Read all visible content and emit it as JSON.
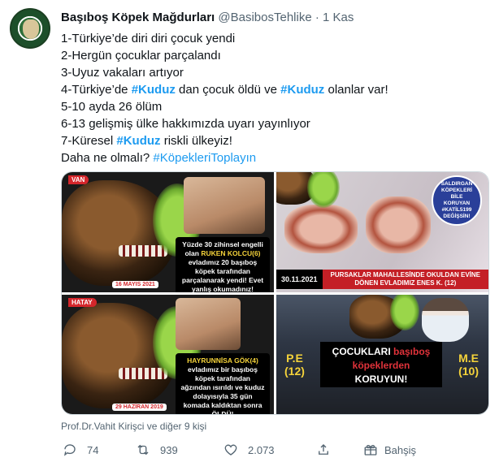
{
  "tweet": {
    "author_name": "Başıboş Köpek Mağdurları",
    "handle": "@BasibosTehlike",
    "separator": "·",
    "time": "1 Kas",
    "lines": [
      {
        "text": "1-Türkiye’de diri diri çocuk yendi"
      },
      {
        "text": "2-Hergün çocuklar parçalandı"
      },
      {
        "text": "3-Uyuz vakaları artıyor"
      },
      {
        "before": "4-Türkiye’de ",
        "tag1": "#Kuduz",
        "middle": " dan çocuk öldü ve ",
        "tag2": "#Kuduz",
        "after": " olanlar var!"
      },
      {
        "text": "5-10 ayda 26 ölüm"
      },
      {
        "text": "6-13 gelişmiş ülke hakkımızda uyarı yayınlıyor"
      },
      {
        "before": "7-Küresel ",
        "tag1": "#Kuduz",
        "after": " riskli ülkeyiz!"
      },
      {
        "before": "Daha ne olmalı? ",
        "tag1": "#KöpekleriToplayın"
      }
    ]
  },
  "media": {
    "tile1": {
      "location": "VAN",
      "caption_part1": "Yüzde 30 zihinsel engelli olan ",
      "caption_name": "RUKEN KOLCU(6)",
      "caption_part2": " evladımız 20 başıboş köpek tarafından parçalanarak yendi! Evet yanlış okumadınız!",
      "date": "16 MAYIS 2021"
    },
    "tile2": {
      "badge": "SALDIRGAN KÖPEKLERİ BİLE KORUYAN #KATİL5199 DEĞİŞSİN!",
      "date": "30.11.2021",
      "banner": "PURSAKLAR MAHALLESİNDE OKULDAN EVİNE DÖNEN EVLADIMIZ ENES K. (12)"
    },
    "tile3": {
      "location": "HATAY",
      "caption_name": "HAYRUNNİSA GÖK(4)",
      "caption_part2": " evladımız bir başıboş köpek tarafından ağzından ısırıldı ve kuduz dolayısıyla 35 gün komada kaldıktan sonra ÖLDÜ!",
      "date": "29 HAZİRAN 2019"
    },
    "tile4": {
      "title_line1_a": "ÇOCUKLARI ",
      "title_line1_b": "başıboş",
      "title_line2": "köpeklerden",
      "title_line3": "KORUYUN!",
      "left_initials": "P.E",
      "left_age": "(12)",
      "right_initials": "M.E",
      "right_age": "(10)"
    }
  },
  "liked_by": "Prof.Dr.Vahit Kirişci ve diğer 9 kişi",
  "actions": {
    "reply_count": "74",
    "retweet_count": "939",
    "like_count": "2.073",
    "share_label": "",
    "tip_label": "Bahşiş"
  }
}
